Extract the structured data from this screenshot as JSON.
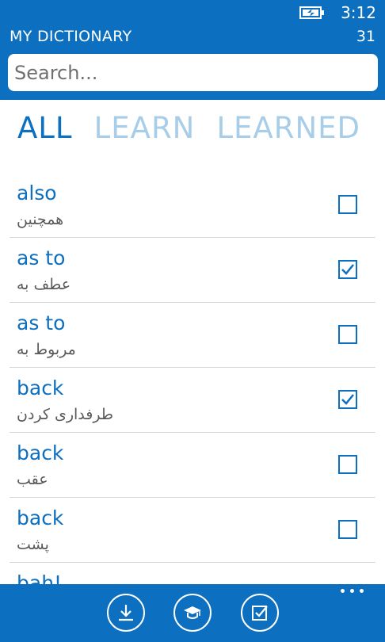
{
  "status_bar": {
    "time": "3:12",
    "battery_icon": "battery-charging-icon"
  },
  "header": {
    "title": "MY DICTIONARY",
    "count": "31"
  },
  "search": {
    "placeholder": "Search..."
  },
  "tabs": [
    {
      "label": "ALL",
      "active": true
    },
    {
      "label": "LEARN",
      "active": false
    },
    {
      "label": "LEARNED",
      "active": false
    }
  ],
  "entries": [
    {
      "word": "also",
      "meaning": "همچنین",
      "checked": false
    },
    {
      "word": "as to",
      "meaning": "عطف به",
      "checked": true
    },
    {
      "word": "as to",
      "meaning": "مربوط به",
      "checked": false
    },
    {
      "word": "back",
      "meaning": "طرفداری کردن",
      "checked": true
    },
    {
      "word": "back",
      "meaning": "عقب",
      "checked": false
    },
    {
      "word": "back",
      "meaning": "پشت",
      "checked": false
    },
    {
      "word": "bah!",
      "meaning": "",
      "checked": false
    }
  ],
  "app_bar": {
    "buttons": [
      {
        "icon": "download-icon"
      },
      {
        "icon": "graduation-cap-icon"
      },
      {
        "icon": "checklist-icon"
      }
    ],
    "more_icon": "more-options-icon"
  },
  "colors": {
    "accent": "#0c6fbf",
    "inactive_tab": "#a7cde9"
  }
}
